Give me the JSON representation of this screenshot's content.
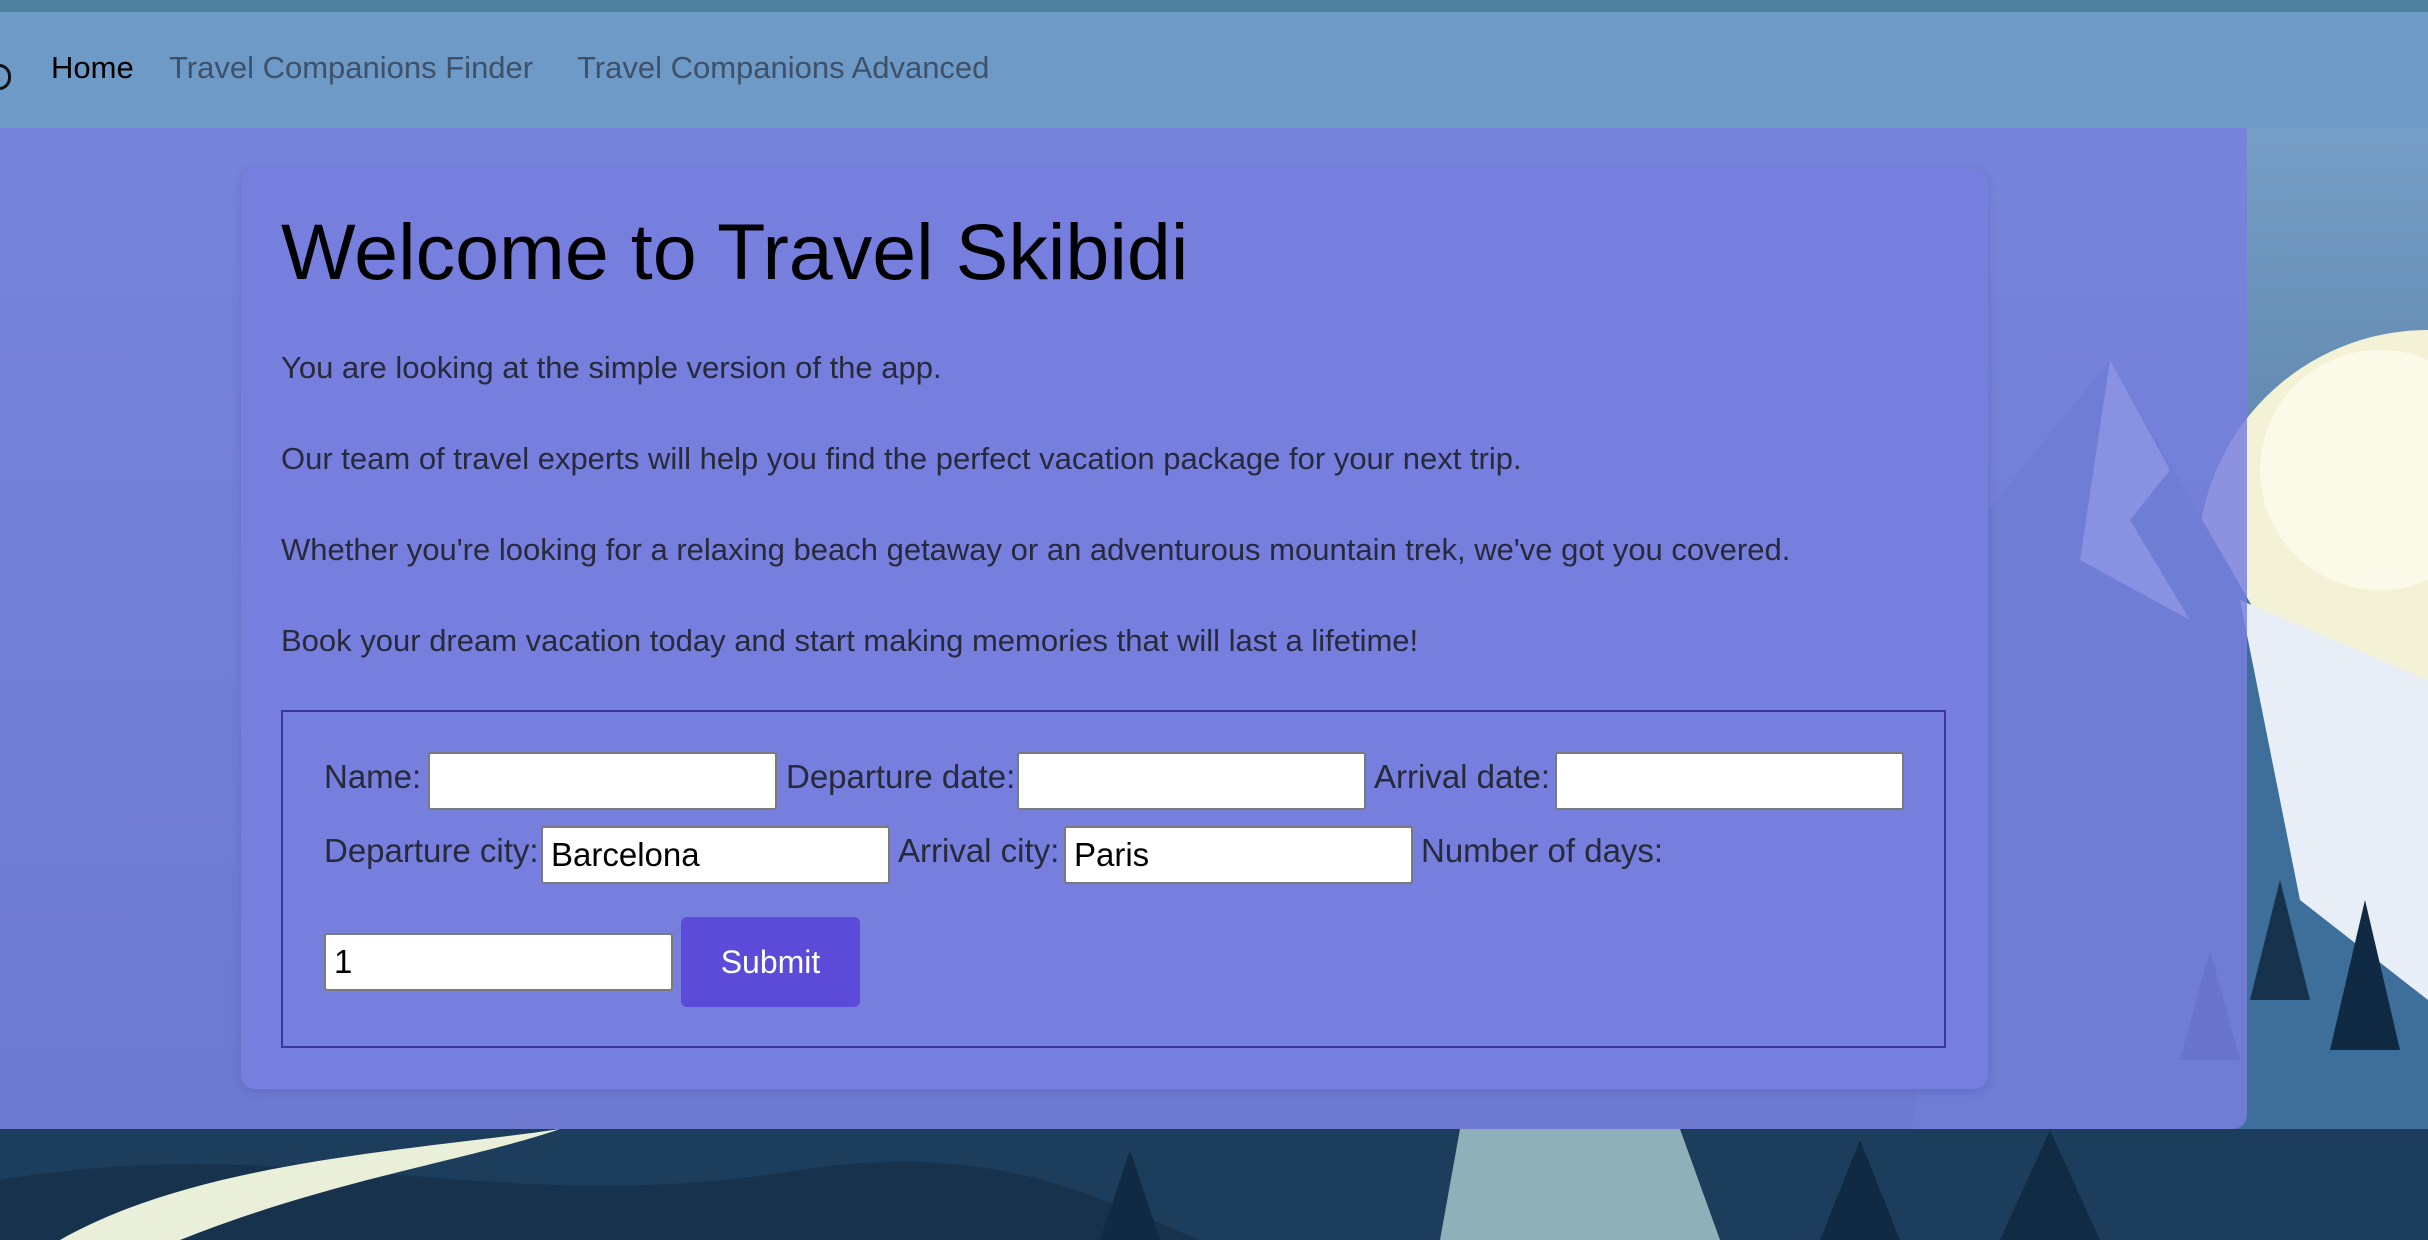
{
  "nav": {
    "items": [
      {
        "label": "Home",
        "active": true
      },
      {
        "label": "Travel Companions Finder",
        "active": false
      },
      {
        "label": "Travel Companions Advanced",
        "active": false
      }
    ]
  },
  "main": {
    "title": "Welcome to Travel Skibidi",
    "paragraphs": [
      "You are looking at the simple version of the app.",
      "Our team of travel experts will help you find the perfect vacation package for your next trip.",
      "Whether you're looking for a relaxing beach getaway or an adventurous mountain trek, we've got you covered.",
      "Book your dream vacation today and start making memories that will last a lifetime!"
    ]
  },
  "form": {
    "name_label": "Name:",
    "name_value": "",
    "departure_date_label": "Departure date:",
    "departure_date_value": "",
    "arrival_date_label": "Arrival date:",
    "arrival_date_value": "",
    "departure_city_label": "Departure city:",
    "departure_city_value": "Barcelona",
    "arrival_city_label": "Arrival city:",
    "arrival_city_value": "Paris",
    "days_label": "Number of days:",
    "days_value": "1",
    "submit_label": "Submit"
  },
  "colors": {
    "navbar": "#6e9ac8",
    "panel": "#787fe0",
    "submit_button": "#5b4bd8",
    "form_border": "#3a35a0"
  }
}
